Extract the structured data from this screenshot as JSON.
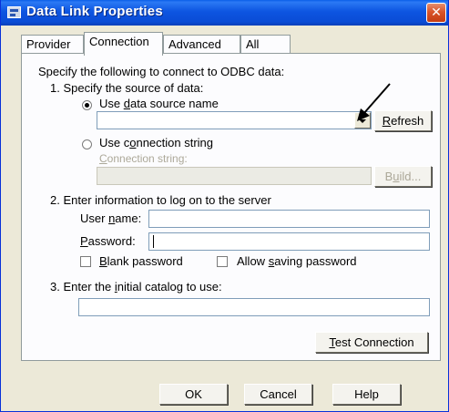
{
  "window": {
    "title": "Data Link Properties",
    "close_glyph": "✕"
  },
  "tabs": [
    "Provider",
    "Connection",
    "Advanced",
    "All"
  ],
  "connection": {
    "intro": "Specify the following to connect to ODBC data:",
    "step1": "1. Specify the source of data:",
    "use_dsn": {
      "pre": "Use ",
      "u": "d",
      "post": "ata source name"
    },
    "dsn_value": "",
    "refresh": {
      "u": "R",
      "post": "efresh"
    },
    "use_conn_string": {
      "pre": "Use c",
      "u": "o",
      "post": "nnection string"
    },
    "conn_string_label": {
      "u": "C",
      "post": "onnection string:"
    },
    "conn_string_value": "",
    "build": {
      "pre": "B",
      "u": "u",
      "post": "ild..."
    },
    "step2": "2. Enter information to log on to the server",
    "user_name": {
      "pre": "User ",
      "u": "n",
      "post": "ame:"
    },
    "user_value": "",
    "password": {
      "pre": "",
      "u": "P",
      "post": "assword:"
    },
    "password_value": "",
    "blank_password": {
      "pre": "",
      "u": "B",
      "post": "lank password"
    },
    "allow_saving": {
      "pre": "Allow ",
      "u": "s",
      "post": "aving password"
    },
    "step3": {
      "pre": "3. Enter the ",
      "u": "i",
      "post": "nitial catalog to use:"
    },
    "catalog_value": "",
    "test_connection": {
      "pre": "",
      "u": "T",
      "post": "est Connection"
    }
  },
  "footer": {
    "ok": "OK",
    "cancel": "Cancel",
    "help": "Help"
  }
}
